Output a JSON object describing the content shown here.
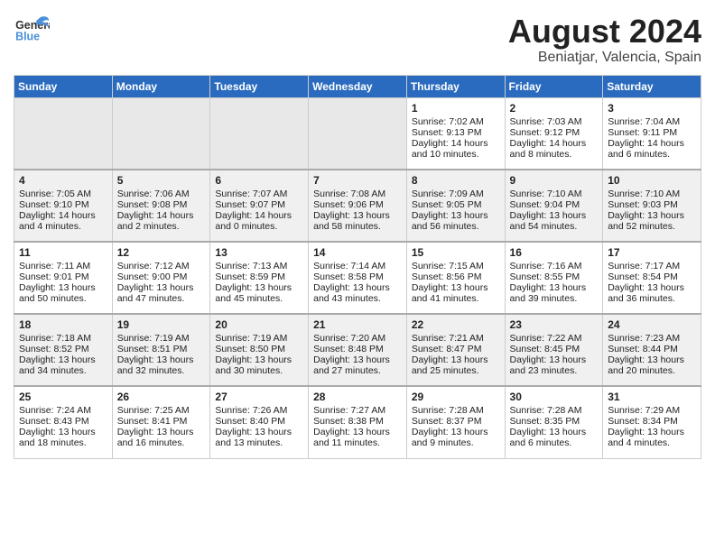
{
  "header": {
    "logo_general": "General",
    "logo_blue": "Blue",
    "month": "August 2024",
    "location": "Beniatjar, Valencia, Spain"
  },
  "days_of_week": [
    "Sunday",
    "Monday",
    "Tuesday",
    "Wednesday",
    "Thursday",
    "Friday",
    "Saturday"
  ],
  "weeks": [
    {
      "cells": [
        {
          "day": "",
          "info": ""
        },
        {
          "day": "",
          "info": ""
        },
        {
          "day": "",
          "info": ""
        },
        {
          "day": "",
          "info": ""
        },
        {
          "day": "1",
          "info": "Sunrise: 7:02 AM\nSunset: 9:13 PM\nDaylight: 14 hours\nand 10 minutes."
        },
        {
          "day": "2",
          "info": "Sunrise: 7:03 AM\nSunset: 9:12 PM\nDaylight: 14 hours\nand 8 minutes."
        },
        {
          "day": "3",
          "info": "Sunrise: 7:04 AM\nSunset: 9:11 PM\nDaylight: 14 hours\nand 6 minutes."
        }
      ]
    },
    {
      "cells": [
        {
          "day": "4",
          "info": "Sunrise: 7:05 AM\nSunset: 9:10 PM\nDaylight: 14 hours\nand 4 minutes."
        },
        {
          "day": "5",
          "info": "Sunrise: 7:06 AM\nSunset: 9:08 PM\nDaylight: 14 hours\nand 2 minutes."
        },
        {
          "day": "6",
          "info": "Sunrise: 7:07 AM\nSunset: 9:07 PM\nDaylight: 14 hours\nand 0 minutes."
        },
        {
          "day": "7",
          "info": "Sunrise: 7:08 AM\nSunset: 9:06 PM\nDaylight: 13 hours\nand 58 minutes."
        },
        {
          "day": "8",
          "info": "Sunrise: 7:09 AM\nSunset: 9:05 PM\nDaylight: 13 hours\nand 56 minutes."
        },
        {
          "day": "9",
          "info": "Sunrise: 7:10 AM\nSunset: 9:04 PM\nDaylight: 13 hours\nand 54 minutes."
        },
        {
          "day": "10",
          "info": "Sunrise: 7:10 AM\nSunset: 9:03 PM\nDaylight: 13 hours\nand 52 minutes."
        }
      ]
    },
    {
      "cells": [
        {
          "day": "11",
          "info": "Sunrise: 7:11 AM\nSunset: 9:01 PM\nDaylight: 13 hours\nand 50 minutes."
        },
        {
          "day": "12",
          "info": "Sunrise: 7:12 AM\nSunset: 9:00 PM\nDaylight: 13 hours\nand 47 minutes."
        },
        {
          "day": "13",
          "info": "Sunrise: 7:13 AM\nSunset: 8:59 PM\nDaylight: 13 hours\nand 45 minutes."
        },
        {
          "day": "14",
          "info": "Sunrise: 7:14 AM\nSunset: 8:58 PM\nDaylight: 13 hours\nand 43 minutes."
        },
        {
          "day": "15",
          "info": "Sunrise: 7:15 AM\nSunset: 8:56 PM\nDaylight: 13 hours\nand 41 minutes."
        },
        {
          "day": "16",
          "info": "Sunrise: 7:16 AM\nSunset: 8:55 PM\nDaylight: 13 hours\nand 39 minutes."
        },
        {
          "day": "17",
          "info": "Sunrise: 7:17 AM\nSunset: 8:54 PM\nDaylight: 13 hours\nand 36 minutes."
        }
      ]
    },
    {
      "cells": [
        {
          "day": "18",
          "info": "Sunrise: 7:18 AM\nSunset: 8:52 PM\nDaylight: 13 hours\nand 34 minutes."
        },
        {
          "day": "19",
          "info": "Sunrise: 7:19 AM\nSunset: 8:51 PM\nDaylight: 13 hours\nand 32 minutes."
        },
        {
          "day": "20",
          "info": "Sunrise: 7:19 AM\nSunset: 8:50 PM\nDaylight: 13 hours\nand 30 minutes."
        },
        {
          "day": "21",
          "info": "Sunrise: 7:20 AM\nSunset: 8:48 PM\nDaylight: 13 hours\nand 27 minutes."
        },
        {
          "day": "22",
          "info": "Sunrise: 7:21 AM\nSunset: 8:47 PM\nDaylight: 13 hours\nand 25 minutes."
        },
        {
          "day": "23",
          "info": "Sunrise: 7:22 AM\nSunset: 8:45 PM\nDaylight: 13 hours\nand 23 minutes."
        },
        {
          "day": "24",
          "info": "Sunrise: 7:23 AM\nSunset: 8:44 PM\nDaylight: 13 hours\nand 20 minutes."
        }
      ]
    },
    {
      "cells": [
        {
          "day": "25",
          "info": "Sunrise: 7:24 AM\nSunset: 8:43 PM\nDaylight: 13 hours\nand 18 minutes."
        },
        {
          "day": "26",
          "info": "Sunrise: 7:25 AM\nSunset: 8:41 PM\nDaylight: 13 hours\nand 16 minutes."
        },
        {
          "day": "27",
          "info": "Sunrise: 7:26 AM\nSunset: 8:40 PM\nDaylight: 13 hours\nand 13 minutes."
        },
        {
          "day": "28",
          "info": "Sunrise: 7:27 AM\nSunset: 8:38 PM\nDaylight: 13 hours\nand 11 minutes."
        },
        {
          "day": "29",
          "info": "Sunrise: 7:28 AM\nSunset: 8:37 PM\nDaylight: 13 hours\nand 9 minutes."
        },
        {
          "day": "30",
          "info": "Sunrise: 7:28 AM\nSunset: 8:35 PM\nDaylight: 13 hours\nand 6 minutes."
        },
        {
          "day": "31",
          "info": "Sunrise: 7:29 AM\nSunset: 8:34 PM\nDaylight: 13 hours\nand 4 minutes."
        }
      ]
    }
  ]
}
